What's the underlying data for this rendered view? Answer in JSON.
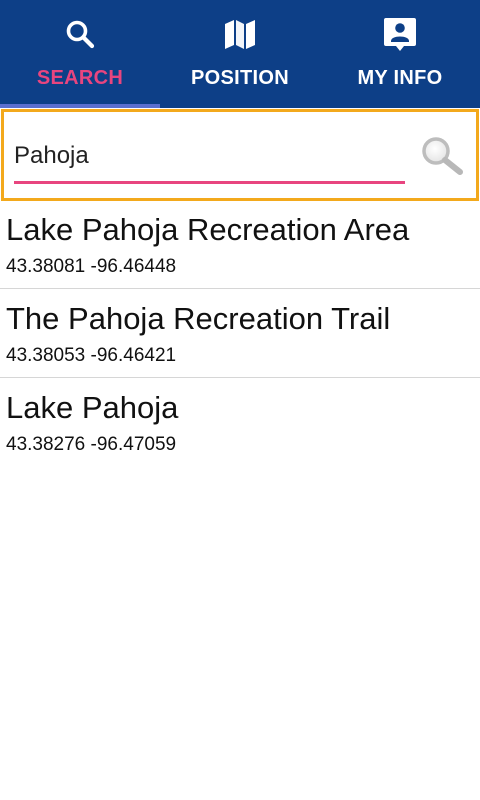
{
  "tabs": [
    {
      "label": "SEARCH",
      "icon": "search-icon",
      "active": true
    },
    {
      "label": "POSITION",
      "icon": "map-icon",
      "active": false
    },
    {
      "label": "MY INFO",
      "icon": "contact-card-icon",
      "active": false
    }
  ],
  "search": {
    "value": "Pahoja",
    "placeholder": "",
    "button_icon": "magnifier-icon"
  },
  "results": [
    {
      "name": "Lake Pahoja Recreation Area",
      "coords": "43.38081 -96.46448"
    },
    {
      "name": "The Pahoja Recreation Trail",
      "coords": "43.38053 -96.46421"
    },
    {
      "name": "Lake Pahoja",
      "coords": "43.38276 -96.47059"
    }
  ],
  "colors": {
    "tabbar_bg": "#0d3f87",
    "active_accent": "#e8457f",
    "tab_indicator": "#5a6fcf",
    "search_border": "#f3a91c",
    "divider": "#d6d6d6"
  }
}
